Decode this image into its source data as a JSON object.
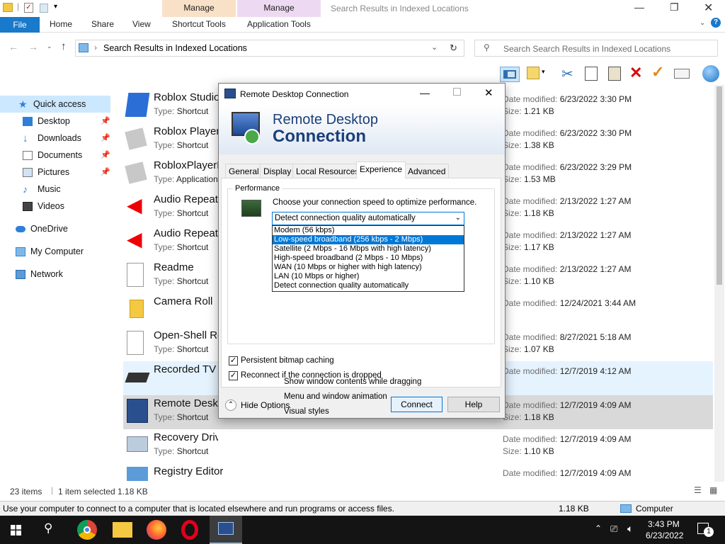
{
  "window": {
    "title": "Search Results in Indexed Locations",
    "ctx_tabs": [
      "Manage",
      "Manage"
    ],
    "tabs": [
      "File",
      "Home",
      "Share",
      "View",
      "Shortcut Tools",
      "Application Tools"
    ]
  },
  "address": {
    "path": "Search Results in Indexed Locations",
    "search_placeholder": "Search Search Results in Indexed Locations"
  },
  "nav": {
    "quick_access": "Quick access",
    "items": [
      "Desktop",
      "Downloads",
      "Documents",
      "Pictures",
      "Music",
      "Videos"
    ],
    "onedrive": "OneDrive",
    "my_computer": "My Computer",
    "network": "Network"
  },
  "files": [
    {
      "name": "Roblox Studio",
      "type": "Shortcut",
      "date": "6/23/2022 3:30 PM",
      "size": "1.21 KB"
    },
    {
      "name": "Roblox Player",
      "type": "Shortcut",
      "date": "6/23/2022 3:30 PM",
      "size": "1.38 KB"
    },
    {
      "name": "RobloxPlayerLauncher",
      "type": "Application",
      "date": "6/23/2022 3:29 PM",
      "size": "1.53 MB"
    },
    {
      "name": "Audio Repeater (KS)",
      "type": "Shortcut",
      "date": "2/13/2022 1:27 AM",
      "size": "1.18 KB"
    },
    {
      "name": "Audio Repeater (MME)",
      "type": "Shortcut",
      "date": "2/13/2022 1:27 AM",
      "size": "1.17 KB"
    },
    {
      "name": "Readme",
      "type": "Shortcut",
      "date": "2/13/2022 1:27 AM",
      "size": "1.10 KB"
    },
    {
      "name": "Camera Roll",
      "type": "",
      "date": "12/24/2021 3:44 AM",
      "size": ""
    },
    {
      "name": "Open-Shell Readme",
      "type": "Shortcut",
      "date": "8/27/2021 5:18 AM",
      "size": "1.07 KB"
    },
    {
      "name": "Recorded TV",
      "type": "",
      "date": "12/7/2019 4:12 AM",
      "size": ""
    },
    {
      "name": "Remote Desktop Connection",
      "type": "Shortcut",
      "date": "12/7/2019 4:09 AM",
      "size": "1.18 KB"
    },
    {
      "name": "Recovery Drive",
      "type": "Shortcut",
      "date": "12/7/2019 4:09 AM",
      "size": "1.10 KB"
    },
    {
      "name": "Registry Editor",
      "type": "",
      "date": "12/7/2019 4:09 AM",
      "size": ""
    }
  ],
  "labels": {
    "type": "Type:",
    "date": "Date modified:",
    "size": "Size:"
  },
  "status": {
    "count": "23 items",
    "selected": "1 item selected  1.18 KB"
  },
  "infobar": {
    "text": "Use your computer to connect to a computer that is located elsewhere and run programs or access files.",
    "size": "1.18 KB",
    "location": "Computer"
  },
  "dialog": {
    "title": "Remote Desktop Connection",
    "banner_line1": "Remote Desktop",
    "banner_line2": "Connection",
    "tabs": [
      "General",
      "Display",
      "Local Resources",
      "Experience",
      "Advanced"
    ],
    "group": "Performance",
    "prompt": "Choose your connection speed to optimize performance.",
    "selected_value": "Detect connection quality automatically",
    "options": [
      "Modem (56 kbps)",
      "Low-speed broadband (256 kbps - 2 Mbps)",
      "Satellite (2 Mbps - 16 Mbps with high latency)",
      "High-speed broadband (2 Mbps - 10 Mbps)",
      "WAN (10 Mbps or higher with high latency)",
      "LAN (10 Mbps or higher)",
      "Detect connection quality automatically"
    ],
    "features": [
      "Show window contents while dragging",
      "Menu and window animation",
      "Visual styles"
    ],
    "persistent": "Persistent bitmap caching",
    "reconnect": "Reconnect if the connection is dropped",
    "hide_options": "Hide Options",
    "connect": "Connect",
    "help": "Help"
  },
  "taskbar": {
    "time": "3:43 PM",
    "date": "6/23/2022",
    "notif": "1"
  },
  "colors": {
    "accent": "#0078d7",
    "file_tab": "#1979ca",
    "selected_row": "#d9d9d9",
    "hover_row": "#e5f3ff"
  }
}
